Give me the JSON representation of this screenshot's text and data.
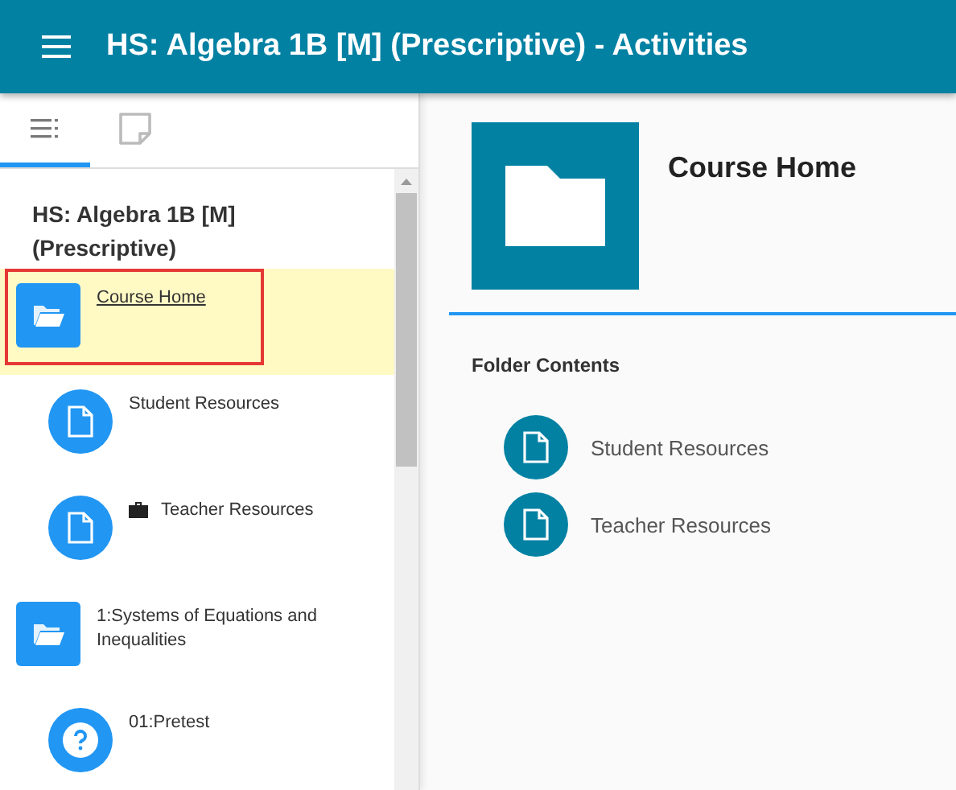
{
  "header": {
    "title": "HS: Algebra 1B [M] (Prescriptive) - Activities"
  },
  "sidebar": {
    "tabs": [
      {
        "kind": "outline",
        "selected": true
      },
      {
        "kind": "notes",
        "selected": false
      }
    ],
    "course_title": "HS: Algebra 1B [M] (Prescriptive)",
    "items": [
      {
        "kind": "folder",
        "label": "Course Home",
        "selected": true,
        "children": [
          {
            "kind": "page",
            "label": "Student Resources",
            "selected": false,
            "teacher_only": false
          },
          {
            "kind": "page",
            "label": "Teacher Resources",
            "selected": false,
            "teacher_only": true
          }
        ]
      },
      {
        "kind": "folder",
        "label": "1:Systems of Equations and Inequalities",
        "selected": false,
        "children": [
          {
            "kind": "quiz",
            "label": "01:Pretest",
            "selected": false,
            "teacher_only": false
          }
        ]
      }
    ]
  },
  "main": {
    "title": "Course Home",
    "section_title": "Folder Contents",
    "contents": [
      {
        "kind": "page",
        "label": "Student Resources"
      },
      {
        "kind": "page",
        "label": "Teacher Resources"
      }
    ]
  }
}
